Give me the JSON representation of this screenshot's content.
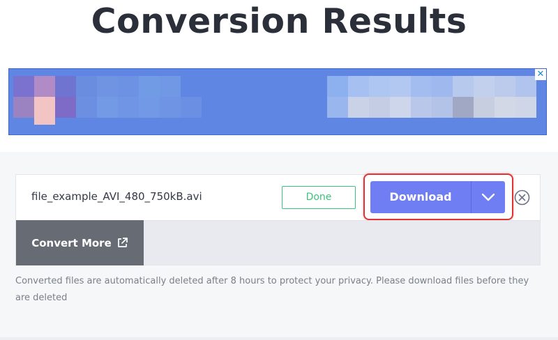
{
  "header": {
    "title": "Conversion Results"
  },
  "ad": {
    "close_icon": "close-icon",
    "close_glyph": "✕",
    "colors": {
      "background": "#5e86e2",
      "left_block": [
        "#8b79c8",
        "#a98bc6",
        "#6d73d0",
        "#f3c4c4",
        "#9b82c3",
        "#7a6bc9"
      ],
      "right_block": [
        "#8fb0ee",
        "#a8c0f0",
        "#b9c8ee",
        "#c3cee8",
        "#9aa5c8",
        "#d0d6e6"
      ]
    }
  },
  "file": {
    "name": "file_example_AVI_480_750kB.avi",
    "status": "Done",
    "download_label": "Download",
    "dropdown_icon": "chevron-down-icon",
    "remove_icon": "close-circle-icon"
  },
  "actions": {
    "convert_more_label": "Convert More",
    "convert_more_icon": "external-link-icon"
  },
  "note": {
    "text": "Converted files are automatically deleted after 8 hours to protect your privacy. Please download files before they are deleted"
  },
  "colors": {
    "accent": "#6f7ef3",
    "success": "#3cc47c",
    "highlight": "#e13333",
    "title": "#2b2f3a"
  }
}
